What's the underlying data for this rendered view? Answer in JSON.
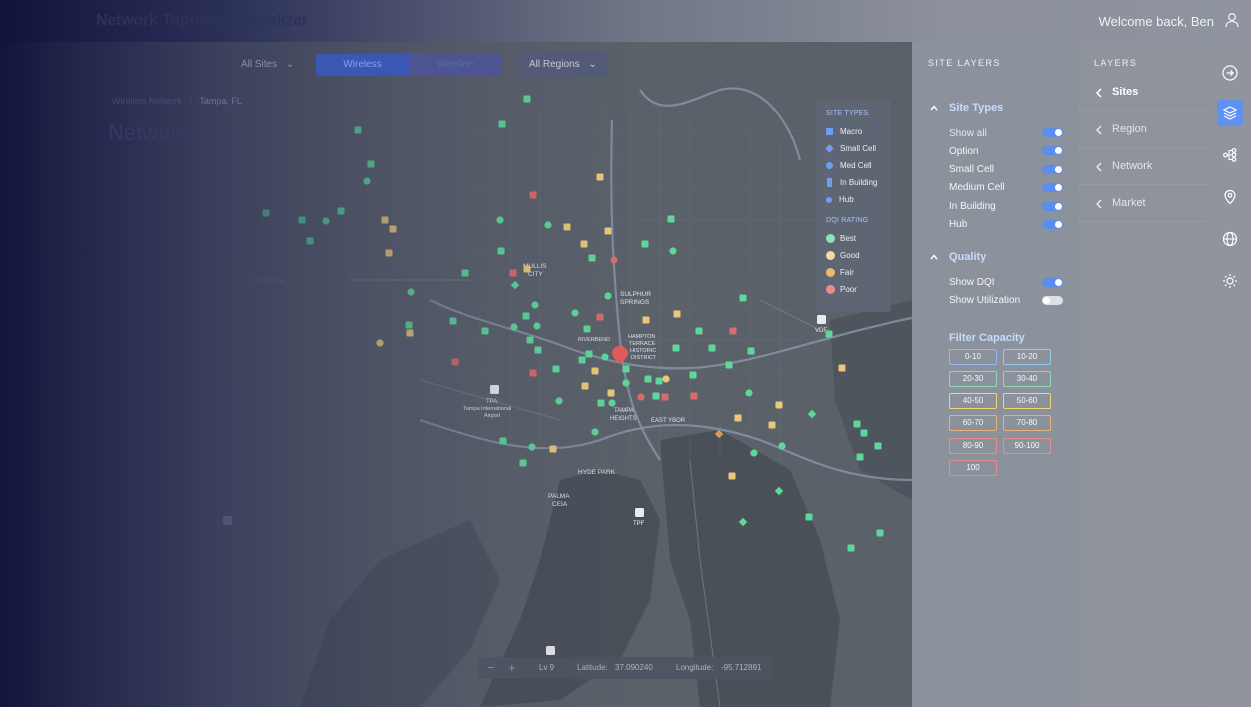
{
  "app": {
    "title": "Network Topology Visualizer",
    "welcome": "Welcome back, Ben"
  },
  "toolbar": {
    "sites_dropdown": "All Sites",
    "tab_wireless": "Wireless",
    "tab_wireline": "Wireline",
    "regions_dropdown": "All Regions"
  },
  "breadcrumb": {
    "parent": "Wireless Network",
    "current": "Tampa, FL"
  },
  "page_title": "Network",
  "map": {
    "labels": {
      "oldsmar": "OLDSMAR",
      "mullis_city": "MULLIS\nCITY",
      "sulphur_springs": "SULPHUR\nSPRINGS",
      "riverbend": "RIVERBEND",
      "hampton_terrace": "HAMPTON\nTERRACE\nHISTORIC\nDISTRICT",
      "tpa": "TPA",
      "tampa_airport": "Tampa International\nAirport",
      "tampa_heights": "TAMPA\nHEIGHTS",
      "east_ybor": "EAST YBOR",
      "hyde_park": "HYDE PARK",
      "palma_ceia": "PALMA\nCEIA",
      "tpf": "TPF",
      "vdf": "VDF"
    },
    "legend": {
      "site_types_title": "SITE TYPES",
      "site_types": [
        "Macro",
        "Small Cell",
        "Med Cell",
        "In Building",
        "Hub"
      ],
      "dqi_title": "DQI RATING",
      "dqi": [
        {
          "label": "Best",
          "color": "#8fe3b2"
        },
        {
          "label": "Good",
          "color": "#f2dda0"
        },
        {
          "label": "Fair",
          "color": "#f0b86a"
        },
        {
          "label": "Poor",
          "color": "#f08a8a"
        }
      ]
    },
    "zoom": {
      "level": "Lv 9",
      "latitude_label": "Latitude:",
      "latitude": "37.090240",
      "longitude_label": "Longitude:",
      "longitude": "-95.712891"
    },
    "colors": {
      "best": "#5ed79a",
      "good": "#e9c877",
      "fair": "#d69a52",
      "poor": "#d86b6b",
      "pin": "#e35a5a"
    }
  },
  "site_layers": {
    "title": "SITE LAYERS",
    "site_types_heading": "Site Types",
    "site_types": [
      {
        "label": "Show all",
        "on": true
      },
      {
        "label": "Option",
        "on": true
      },
      {
        "label": "Small Cell",
        "on": true
      },
      {
        "label": "Medium Cell",
        "on": true
      },
      {
        "label": "In Building",
        "on": true
      },
      {
        "label": "Hub",
        "on": true
      }
    ],
    "quality_heading": "Quality",
    "quality": [
      {
        "label": "Show DQI",
        "on": true
      },
      {
        "label": "Show Utilization",
        "on": false
      }
    ],
    "filter_capacity_heading": "Filter Capacity",
    "capacity": [
      {
        "label": "0-10",
        "color": "#93b8f0"
      },
      {
        "label": "10-20",
        "color": "#93c8f0"
      },
      {
        "label": "20-30",
        "color": "#8fd9b6"
      },
      {
        "label": "30-40",
        "color": "#8fd9b6"
      },
      {
        "label": "40-50",
        "color": "#f1d57a"
      },
      {
        "label": "50-60",
        "color": "#f1d57a"
      },
      {
        "label": "60-70",
        "color": "#e8b277"
      },
      {
        "label": "70-80",
        "color": "#e8b277"
      },
      {
        "label": "80-90",
        "color": "#e88c8c"
      },
      {
        "label": "90-100",
        "color": "#e88c8c"
      },
      {
        "label": "100",
        "color": "#e88c8c"
      }
    ]
  },
  "layers": {
    "title": "LAYERS",
    "items": [
      {
        "label": "Sites",
        "selected": true
      },
      {
        "label": "Region",
        "selected": false
      },
      {
        "label": "Network",
        "selected": false
      },
      {
        "label": "Market",
        "selected": false
      }
    ]
  },
  "rail": {
    "icons": [
      "arrow-right-icon",
      "layers-icon",
      "topology-icon",
      "location-pin-icon",
      "globe-icon",
      "sun-icon"
    ],
    "accent": "#5f91ef"
  }
}
